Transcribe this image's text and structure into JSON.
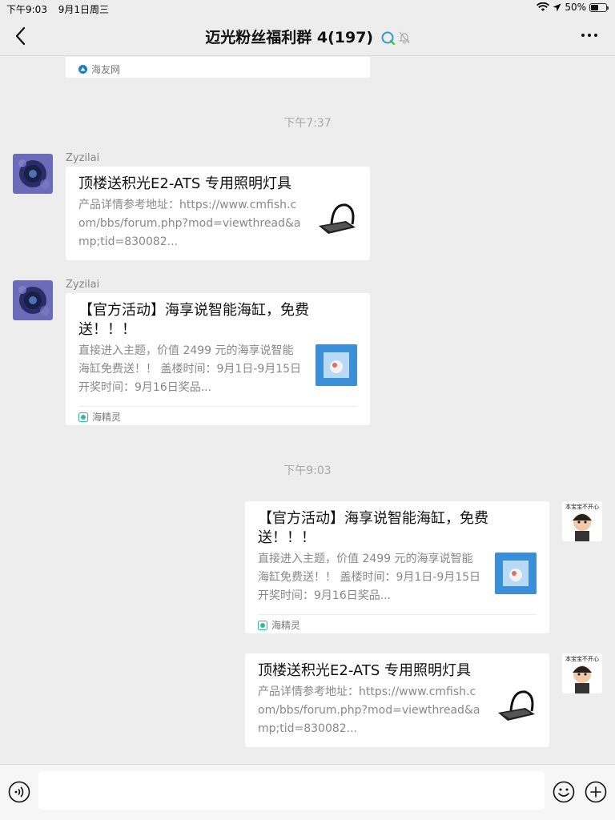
{
  "status_bar": {
    "time": "下午9:03",
    "date": "9月1日周三",
    "battery": "50%",
    "battery_level": 0.5
  },
  "nav": {
    "title": "迈光粉丝福利群 4(197)",
    "back_icon": "chevron-left-icon",
    "more_icon": "more-dots-icon"
  },
  "messages": {
    "partial_card": {
      "source": "海友网"
    },
    "time_1": "下午7:37",
    "msg_1": {
      "sender": "Zyzilai",
      "title": "顶楼送积光E2-ATS 专用照明灯具",
      "desc": "产品详情参考地址：https://www.cmfish.com/bbs/forum.php?mod=viewthread&amp;tid=830082..."
    },
    "msg_2": {
      "sender": "Zyzilai",
      "title": "【官方活动】海享说智能海缸，免费送！！！",
      "desc": "直接进入主题，价值 2499 元的海享说智能海缸免费送！！ 盖楼时间：9月1日-9月15日开奖时间：9月16日奖品...",
      "source": "海精灵"
    },
    "time_2": "下午9:03",
    "msg_3": {
      "title": "【官方活动】海享说智能海缸，免费送！！！",
      "desc": "直接进入主题，价值 2499 元的海享说智能海缸免费送！！ 盖楼时间：9月1日-9月15日开奖时间：9月16日奖品...",
      "source": "海精灵",
      "avatar_caption": "本宝宝不开心"
    },
    "msg_4": {
      "title": "顶楼送积光E2-ATS 专用照明灯具",
      "desc": "产品详情参考地址：https://www.cmfish.com/bbs/forum.php?mod=viewthread&amp;tid=830082...",
      "avatar_caption": "本宝宝不开心"
    }
  },
  "input_bar": {
    "voice_icon": "voice-icon",
    "emoji_icon": "emoji-icon",
    "plus_icon": "plus-icon"
  },
  "colors": {
    "background": "#ededed",
    "card": "#ffffff",
    "meta_text": "#a8a8a8",
    "accent": "#2b9bd8"
  }
}
